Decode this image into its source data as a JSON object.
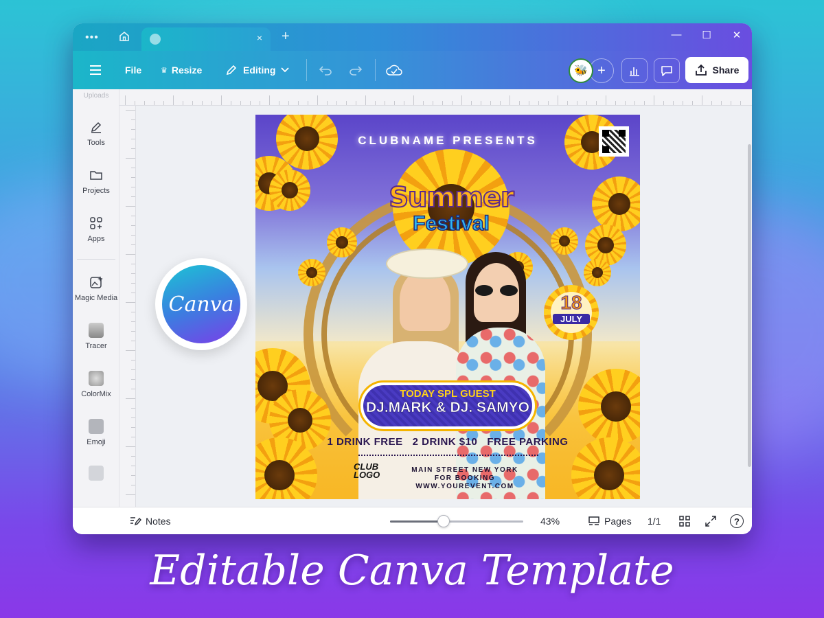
{
  "titlebar": {
    "dots": "•••",
    "tab_close": "×",
    "tab_add": "+",
    "controls": [
      "—",
      "☐",
      "✕"
    ]
  },
  "toolbar": {
    "file": "File",
    "resize": "Resize",
    "editing": "Editing",
    "share": "Share",
    "avatar_emoji": "🐝",
    "plus": "+"
  },
  "sidebar": {
    "partial_top": "Uploads",
    "items": [
      {
        "label": "Tools",
        "icon": "pen-icon"
      },
      {
        "label": "Projects",
        "icon": "folder-icon"
      },
      {
        "label": "Apps",
        "icon": "apps-icon"
      },
      {
        "label": "Magic Media",
        "icon": "magic-media-icon"
      },
      {
        "label": "Tracer",
        "icon": "tracer-thumb"
      },
      {
        "label": "ColorMix",
        "icon": "colormix-thumb"
      },
      {
        "label": "Emoji",
        "icon": "emoji-thumb"
      }
    ]
  },
  "canva_badge": {
    "text": "Canva"
  },
  "flyer": {
    "presents": "CLUBNAME PRESENTS",
    "title_line1": "Summer",
    "title_line2": "Festival",
    "date_day": "18",
    "date_month": "JULY",
    "guest_heading": "TODAY SPL GUEST",
    "guest_names": "DJ.MARK & DJ. SAMYO",
    "offers": "1 DRINK FREE   2 DRINK $10   FREE PARKING",
    "club_logo": "CLUB LOGO",
    "address_line1": "MAIN STREET NEW YORK",
    "address_line2": "FOR BOOKING WWW.YOUREVENT.COM"
  },
  "bottombar": {
    "notes": "Notes",
    "zoom": "43%",
    "zoom_level": 0.4,
    "pages": "Pages",
    "page_count": "1/1",
    "help": "?"
  },
  "caption": "Editable Canva Template",
  "colors": {
    "accent": "#6a4de0",
    "teal": "#1bb6c9",
    "flyer_purple": "#5b45c9",
    "flyer_yellow": "#f7c23a"
  }
}
